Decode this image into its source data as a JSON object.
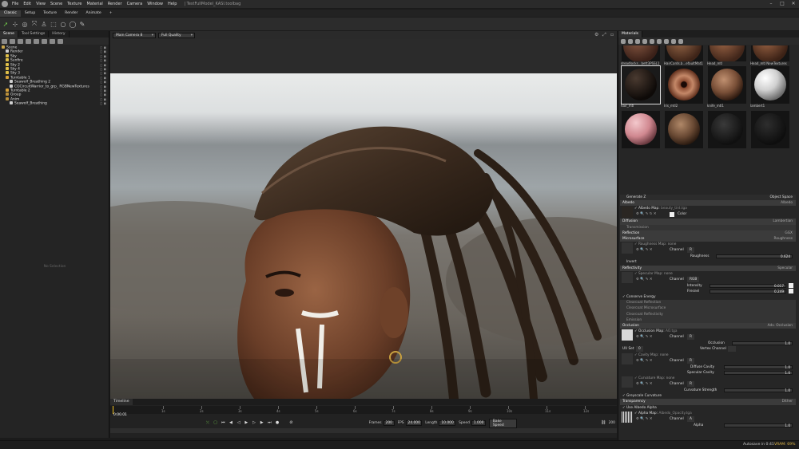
{
  "app": {
    "menu": [
      "File",
      "Edit",
      "View",
      "Scene",
      "Texture",
      "Material",
      "Render",
      "Camera",
      "Window",
      "Help"
    ],
    "window_title": "| TestFullModel_KASI.toolbag"
  },
  "workspace_tabs": [
    "Classic",
    "Setup",
    "Texture",
    "Render",
    "Animate",
    "+"
  ],
  "left_panel": {
    "tabs": [
      "Scene",
      "Tool Settings",
      "History"
    ],
    "tree": [
      {
        "label": "Scene",
        "depth": 0,
        "icon": "scene"
      },
      {
        "label": "Render",
        "depth": 1,
        "icon": "obj"
      },
      {
        "label": "Sky",
        "depth": 1,
        "icon": "sky"
      },
      {
        "label": "Sunfire",
        "depth": 1,
        "icon": "sky"
      },
      {
        "label": "Sky 2",
        "depth": 1,
        "icon": "sky"
      },
      {
        "label": "Sky 4",
        "depth": 1,
        "icon": "sky"
      },
      {
        "label": "Sky 3",
        "depth": 1,
        "icon": "sky"
      },
      {
        "label": "Turntable 1",
        "depth": 1,
        "icon": "tt"
      },
      {
        "label": "Seawolf_Breathing 2",
        "depth": 2,
        "icon": "obj"
      },
      {
        "label": "CGCircuitWarrior_to_grp_ RGBNewTextures",
        "depth": 2,
        "icon": "obj"
      },
      {
        "label": "Turntable 2",
        "depth": 1,
        "icon": "tt"
      },
      {
        "label": "Group",
        "depth": 1,
        "icon": "grp"
      },
      {
        "label": "Anim",
        "depth": 1,
        "icon": "grp"
      },
      {
        "label": "Seawolf_Breathing",
        "depth": 2,
        "icon": "obj"
      }
    ],
    "no_selection": "No Selection"
  },
  "viewport": {
    "camera": "Main Camera 8",
    "quality": "Full Quality"
  },
  "timeline": {
    "tab": "Timeline",
    "ruler": [
      "1s",
      "2s",
      "3s",
      "4s",
      "5s",
      "6s",
      "7s",
      "8s",
      "9s",
      "10s",
      "11s",
      "12s"
    ],
    "current": "0:00.01",
    "frames_label": "Frames",
    "frames": "200",
    "fps_label": "FPS",
    "fps": "24.000",
    "length_label": "Length",
    "length": "10.000",
    "speed_label": "Speed",
    "speed": "1.000",
    "bake_label": "Bake Speed",
    "end": "200"
  },
  "materials": {
    "tab": "Materials",
    "items": [
      {
        "label": "dreadlocks...bett3PSSL1"
      },
      {
        "label": "HairCards.b...efaultMat1"
      },
      {
        "label": "Head_mtl"
      },
      {
        "label": "Head_mtl NewTextures"
      },
      {
        "label": "hair_mtl"
      },
      {
        "label": "Iris_mtl2"
      },
      {
        "label": "knife_mtl1"
      },
      {
        "label": "lambert1"
      },
      {
        "label": ""
      },
      {
        "label": ""
      },
      {
        "label": ""
      },
      {
        "label": ""
      }
    ],
    "generate_label": "Generate Z",
    "object_space_label": "Object Space",
    "sections": {
      "albedo": "Albedo",
      "albedo_right": "Albedo",
      "albedo_map": "Albedo Map",
      "albedo_map_file": "beauty_tint.tga",
      "color_label": "Color",
      "diffusion": "Diffusion",
      "diffusion_right": "Lambertian",
      "transmission": "Transmission",
      "reflection": "Reflection",
      "reflection_right": "GGX",
      "microsurface": "Microsurface",
      "microsurface_right": "Roughness",
      "roughness_map": "Roughness Map",
      "roughness_map_file": "none",
      "channel": "Channel",
      "channel_r": "R",
      "roughness": "Roughness",
      "roughness_value": "0.624",
      "invert": "Invert",
      "reflectivity": "Reflectivity",
      "reflectivity_right": "Specular",
      "specular_map": "Specular Map",
      "specular_map_file": "none",
      "channel_rgb": "RGB",
      "intensity": "Intensity",
      "intensity_value": "0.017",
      "fresnel": "Fresnel",
      "fresnel_value": "0.249",
      "conserve_energy": "Conserve Energy",
      "clearcoat_reflection": "Clearcoat Reflection",
      "clearcoat_microsurface": "Clearcoat Microsurface",
      "clearcoat_reflectivity": "Clearcoat Reflectivity",
      "emission": "Emission",
      "occlusion": "Occlusion",
      "occlusion_right": "Adv. Occlusion",
      "occlusion_map": "Occlusion Map",
      "occlusion_map_file": "AO.tga",
      "occlusion_label": "Occlusion",
      "occlusion_value": "1.0",
      "uv_set": "UV Set",
      "uv_set_value": "0",
      "vertex_channel": "Vertex Channel",
      "cavity_map": "Cavity Map",
      "cavity_map_file": "none",
      "diffuse_cavity": "Diffuse Cavity",
      "diffuse_cavity_value": "1.0",
      "specular_cavity": "Specular Cavity",
      "specular_cavity_value": "1.0",
      "curvature_map": "Curvature Map",
      "curvature_map_file": "none",
      "curvature_strength": "Curvature Strength",
      "curvature_strength_value": "1.0",
      "greyscale_curvature": "Greyscale Curvature",
      "transparency": "Transparency",
      "transparency_right": "Dither",
      "use_albedo_alpha": "Use Albedo Alpha",
      "alpha_map": "Alpha Map",
      "alpha_map_file": "Albedo_Opacity.tga",
      "channel_a": "A",
      "alpha": "Alpha",
      "alpha_value": "1.0"
    }
  },
  "status": {
    "autosave": "Autosave in 0:41",
    "vram": "VRAM: 69%"
  },
  "colors": {
    "accent_green": "#6fc34a",
    "panel": "#262626",
    "section": "#3b3b3b"
  }
}
